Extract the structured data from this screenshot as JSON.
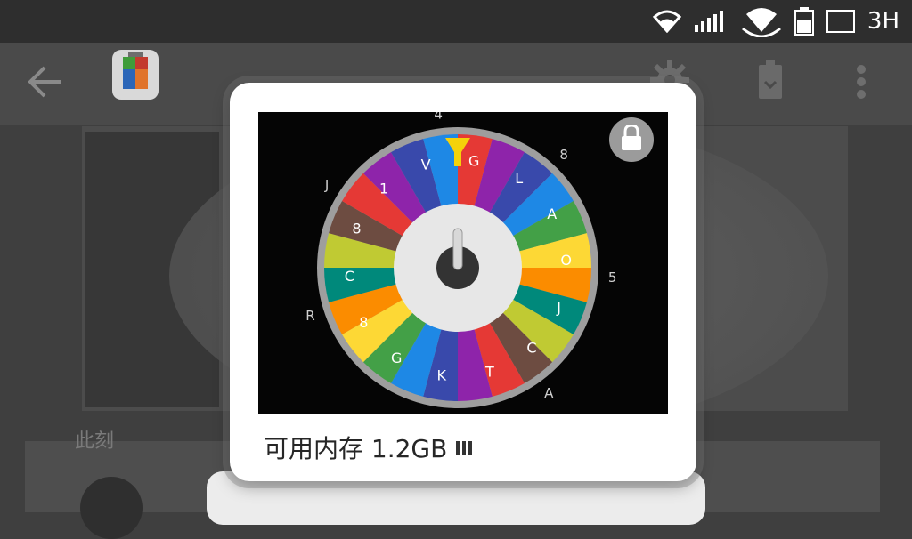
{
  "status_bar": {
    "network_label": "3H",
    "icons": [
      "wifi-icon",
      "signal-bars-icon",
      "hotspot-icon",
      "battery-icon",
      "cast-icon"
    ]
  },
  "app_bar": {
    "icons": [
      "back-arrow-icon",
      "app-icon",
      "settings-gear-icon",
      "battery-saver-icon",
      "more-options-icon"
    ]
  },
  "background": {
    "status_text": "此刻"
  },
  "popup": {
    "memory_label": "可用内存 1.2GB",
    "lock_icon": "lock-icon",
    "wheel": {
      "outer_letters": [
        "R",
        "J",
        "4",
        "8",
        "5",
        "A"
      ],
      "segment_letters": [
        "G",
        "L",
        "A",
        "O",
        "J",
        "C",
        "T",
        "K",
        "G",
        "8",
        "C",
        "8",
        "1",
        "V"
      ],
      "colors": [
        "#e53935",
        "#8e24aa",
        "#3949ab",
        "#1e88e5",
        "#43a047",
        "#fdd835",
        "#fb8c00",
        "#00897b",
        "#c0ca33",
        "#6d4c41"
      ]
    }
  }
}
